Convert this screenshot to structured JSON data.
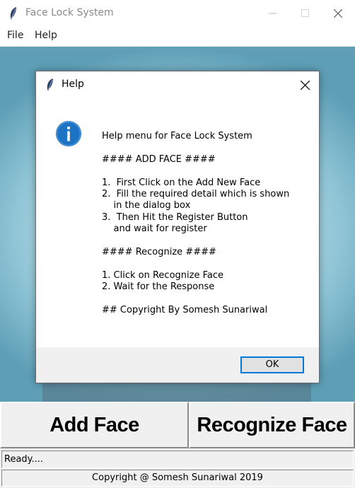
{
  "window": {
    "title": "Face Lock System",
    "icon": "feather-icon"
  },
  "menu": {
    "items": [
      {
        "label": "File"
      },
      {
        "label": "Help"
      }
    ]
  },
  "dialog": {
    "title": "Help",
    "icon": "info-icon",
    "lines": [
      "Help menu for Face Lock System",
      "",
      "#### ADD FACE ####",
      "",
      "1.  First Click on the Add New Face",
      "2.  Fill the required detail which is shown",
      "    in the dialog box",
      "3.  Then Hit the Register Button",
      "    and wait for register",
      "",
      "#### Recognize ####",
      "",
      "1. Click on Recognize Face",
      "2. Wait for the Response",
      "",
      "## Copyright By Somesh Sunariwal"
    ],
    "ok_label": "OK"
  },
  "buttons": {
    "add_face": "Add Face",
    "recognize_face": "Recognize Face"
  },
  "status": {
    "text": "Ready...."
  },
  "footer": {
    "copyright": "Copyright @ Somesh Sunariwal 2019"
  },
  "colors": {
    "accent": "#0078d7",
    "info_icon": "#1c73c4",
    "background_image": "#8fc5d6"
  }
}
